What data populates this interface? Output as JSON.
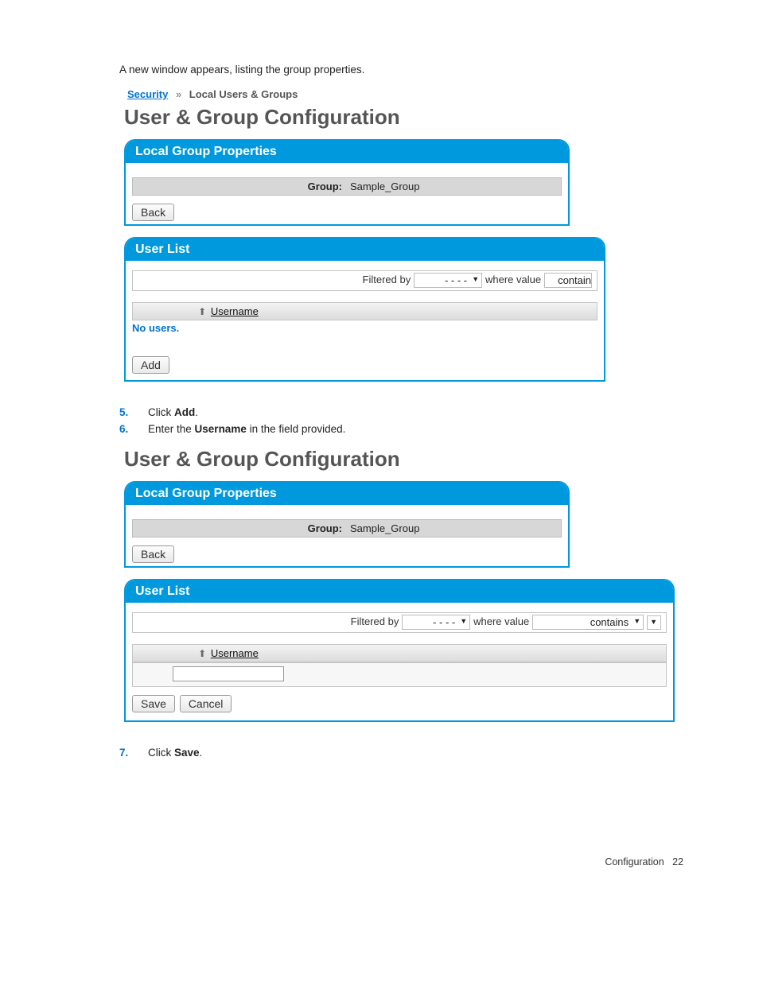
{
  "intro_text": "A new window appears, listing the group properties.",
  "screenshot1": {
    "breadcrumb": {
      "link": "Security",
      "current": "Local Users & Groups"
    },
    "page_title": "User & Group Configuration",
    "panel1": {
      "title": "Local Group Properties",
      "group_label": "Group:",
      "group_value": "Sample_Group",
      "back_btn": "Back"
    },
    "panel2": {
      "title": "User List",
      "filtered_by_label": "Filtered by",
      "filter_value": "- - - -",
      "where_label": "where value",
      "where_value": "contain",
      "col_username": "Username",
      "no_users": "No users.",
      "add_btn": "Add"
    }
  },
  "steps_a": [
    {
      "n": "5.",
      "pre": "Click ",
      "b": "Add",
      "post": "."
    },
    {
      "n": "6.",
      "pre": "Enter the ",
      "b": "Username",
      "post": " in the field provided."
    }
  ],
  "screenshot2": {
    "page_title": "User & Group Configuration",
    "panel1": {
      "title": "Local Group Properties",
      "group_label": "Group:",
      "group_value": "Sample_Group",
      "back_btn": "Back"
    },
    "panel2": {
      "title": "User List",
      "filtered_by_label": "Filtered by",
      "filter_value": "- - - -",
      "where_label": "where value",
      "where_value": "contains",
      "col_username": "Username",
      "save_btn": "Save",
      "cancel_btn": "Cancel"
    }
  },
  "steps_b": [
    {
      "n": "7.",
      "pre": "Click ",
      "b": "Save",
      "post": "."
    }
  ],
  "footer": {
    "label": "Configuration",
    "page": "22"
  }
}
